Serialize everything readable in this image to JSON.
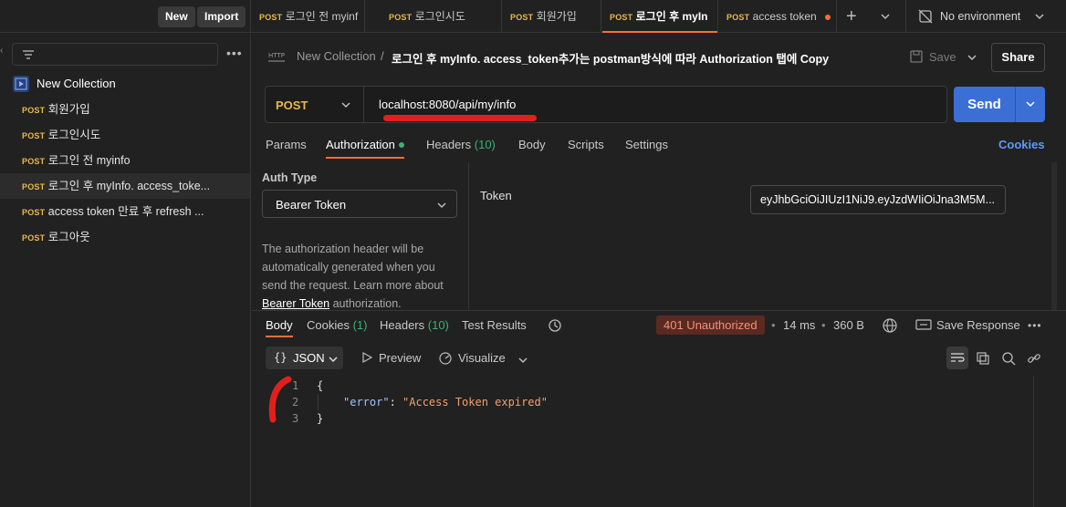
{
  "topbar": {
    "new_label": "New",
    "import_label": "Import",
    "tabs": [
      {
        "method": "POST",
        "label": "로그인 전 myinf"
      },
      {
        "method": "POST",
        "label": "로그인시도"
      },
      {
        "method": "POST",
        "label": "회원가입"
      },
      {
        "method": "POST",
        "label": "로그인 후 myIn"
      },
      {
        "method": "POST",
        "label": "access token"
      }
    ],
    "environment": "No environment"
  },
  "sidebar": {
    "collection_name": "New Collection",
    "items": [
      {
        "method": "POST",
        "label": "회원가입"
      },
      {
        "method": "POST",
        "label": "로그인시도"
      },
      {
        "method": "POST",
        "label": "로그인 전 myinfo"
      },
      {
        "method": "POST",
        "label": "로그인 후 myInfo. access_toke..."
      },
      {
        "method": "POST",
        "label": "access token 만료 후 refresh ..."
      },
      {
        "method": "POST",
        "label": "로그아웃"
      }
    ]
  },
  "request": {
    "breadcrumb_collection": "New Collection",
    "breadcrumb_sep": "/",
    "title": "로그인 후 myInfo. access_token추가는 postman방식에 따라 Authorization 탭에 Copy",
    "save_label": "Save",
    "share_label": "Share",
    "method": "POST",
    "url": "localhost:8080/api/my/info",
    "send_label": "Send",
    "tabs": {
      "params": "Params",
      "authorization": "Authorization",
      "headers": "Headers",
      "headers_count": "(10)",
      "body": "Body",
      "scripts": "Scripts",
      "settings": "Settings",
      "cookies": "Cookies"
    },
    "auth": {
      "type_label": "Auth Type",
      "type_value": "Bearer Token",
      "help_text": "The authorization header will be automatically generated when you send the request. Learn more about",
      "help_link": "Bearer Token",
      "help_suffix": " authorization.",
      "token_label": "Token",
      "token_value": "eyJhbGciOiJIUzI1NiJ9.eyJzdWIiOiJna3M5M..."
    }
  },
  "response": {
    "tabs": {
      "body": "Body",
      "cookies": "Cookies",
      "cookies_count": "(1)",
      "headers": "Headers",
      "headers_count": "(10)",
      "test_results": "Test Results"
    },
    "status": "401 Unauthorized",
    "time": "14 ms",
    "size": "360 B",
    "save_response": "Save Response",
    "format": "JSON",
    "preview": "Preview",
    "visualize": "Visualize",
    "lines": [
      {
        "num": "1",
        "text": "{"
      },
      {
        "num": "2",
        "key": "\"error\"",
        "value": "\"Access Token expired\""
      },
      {
        "num": "3",
        "text": "}"
      }
    ]
  },
  "colors": {
    "accent": "#ff6c37",
    "send": "#3c6fd6",
    "method": "#e9b949",
    "status_error_bg": "#5a2a22",
    "status_error_text": "#f2907a",
    "annotation": "#e0201c"
  }
}
